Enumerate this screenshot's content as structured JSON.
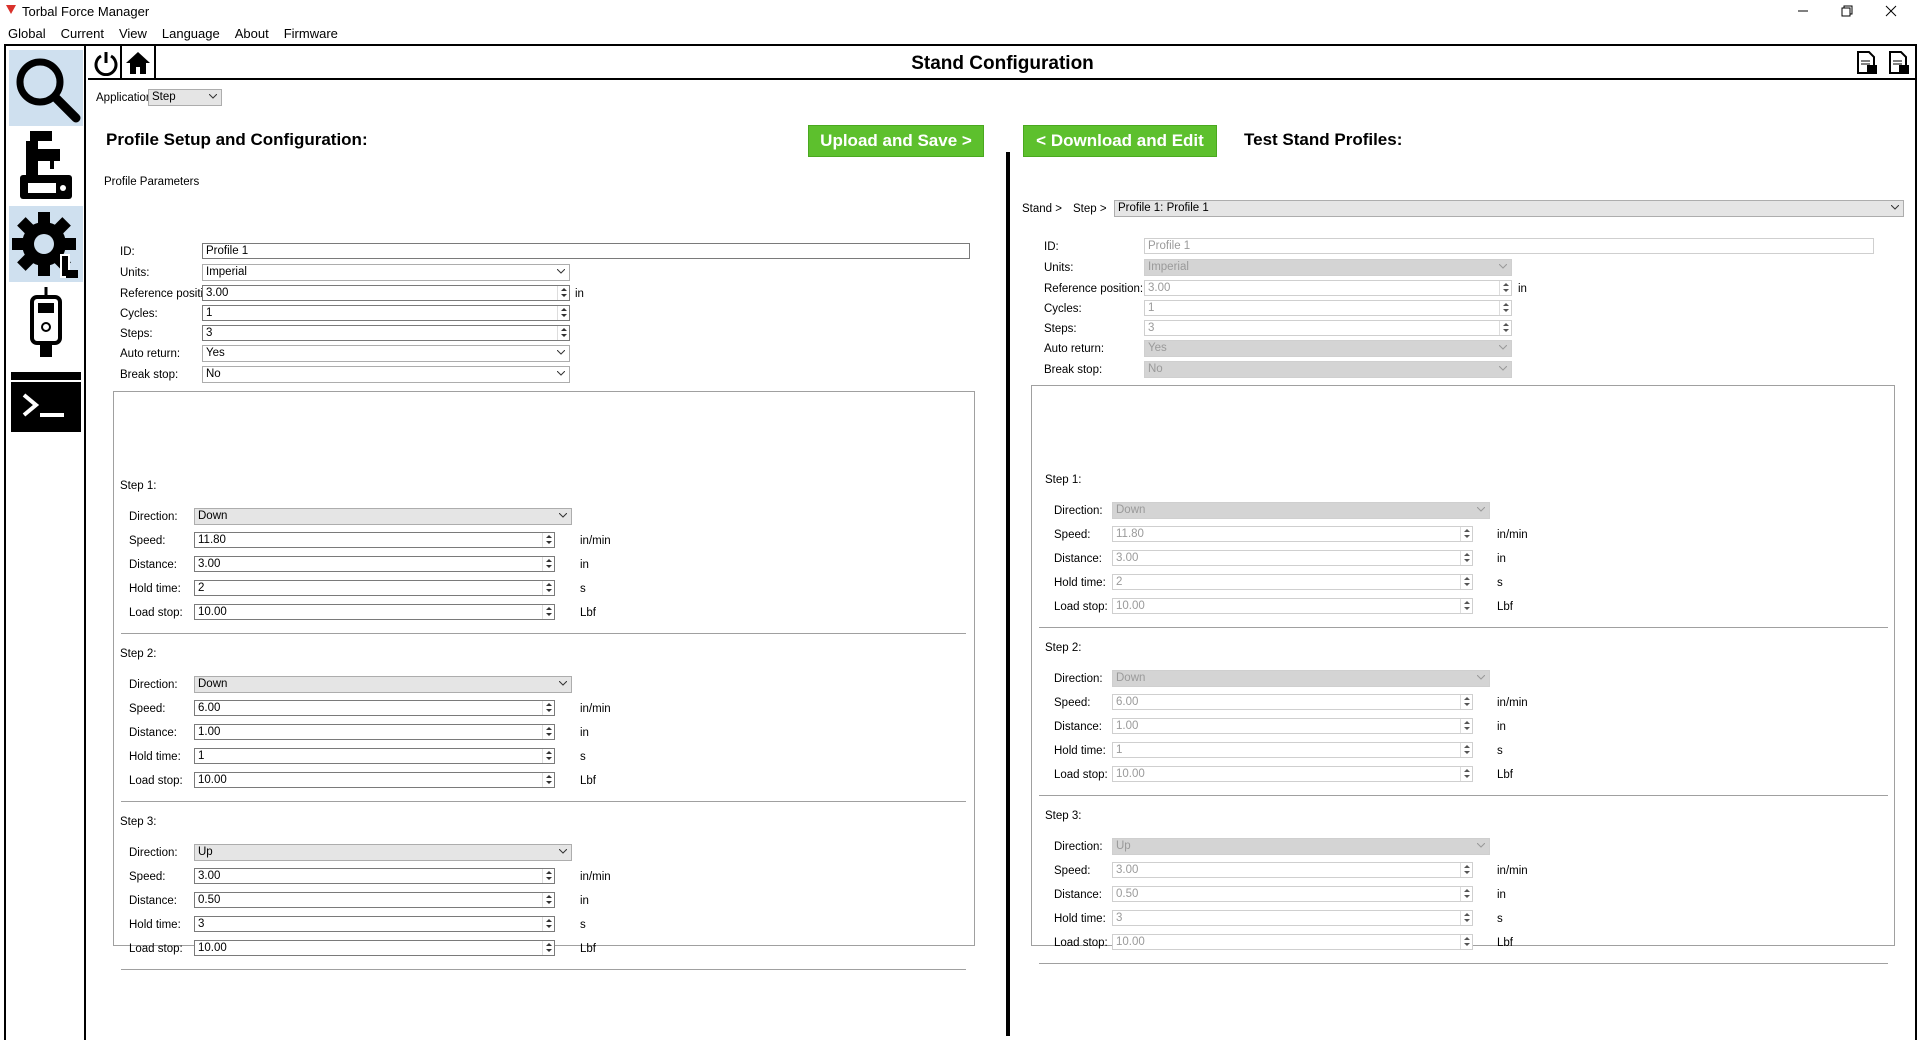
{
  "window": {
    "title": "Torbal Force Manager"
  },
  "menu": [
    "Global",
    "Current",
    "View",
    "Language",
    "About",
    "Firmware"
  ],
  "header": {
    "title": "Stand Configuration"
  },
  "sidebar": {
    "icons": [
      "search-icon",
      "stand-icon",
      "settings-icon",
      "gauge-icon",
      "terminal-icon"
    ]
  },
  "application": {
    "label": "Application:",
    "value": "Step"
  },
  "left": {
    "title": "Profile Setup and Configuration:",
    "upload_label": "Upload and Save >",
    "params_title": "Profile Parameters",
    "fields": {
      "id": {
        "label": "ID:",
        "value": "Profile 1"
      },
      "units": {
        "label": "Units:",
        "value": "Imperial"
      },
      "ref": {
        "label": "Reference position:",
        "value": "3.00",
        "unit": "in"
      },
      "cycles": {
        "label": "Cycles:",
        "value": "1"
      },
      "steps": {
        "label": "Steps:",
        "value": "3"
      },
      "auto": {
        "label": "Auto return:",
        "value": "Yes"
      },
      "brk": {
        "label": "Break stop:",
        "value": "No"
      }
    }
  },
  "right": {
    "title": "Test Stand Profiles:",
    "download_label": "< Download and Edit",
    "crumb1": "Stand >",
    "crumb2": "Step >",
    "profile_select": "Profile 1: Profile 1",
    "fields": {
      "id": {
        "label": "ID:",
        "value": "Profile 1"
      },
      "units": {
        "label": "Units:",
        "value": "Imperial"
      },
      "ref": {
        "label": "Reference position:",
        "value": "3.00",
        "unit": "in"
      },
      "cycles": {
        "label": "Cycles:",
        "value": "1"
      },
      "steps": {
        "label": "Steps:",
        "value": "3"
      },
      "auto": {
        "label": "Auto return:",
        "value": "Yes"
      },
      "brk": {
        "label": "Break stop:",
        "value": "No"
      }
    }
  },
  "step_labels": {
    "direction": "Direction:",
    "speed": "Speed:",
    "distance": "Distance:",
    "hold": "Hold time:",
    "load": "Load stop:"
  },
  "step_units": {
    "speed": "in/min",
    "distance": "in",
    "hold": "s",
    "load": "Lbf"
  },
  "steps": [
    {
      "title": "Step 1:",
      "direction": "Down",
      "speed": "11.80",
      "distance": "3.00",
      "hold": "2",
      "load": "10.00"
    },
    {
      "title": "Step 2:",
      "direction": "Down",
      "speed": "6.00",
      "distance": "1.00",
      "hold": "1",
      "load": "10.00"
    },
    {
      "title": "Step 3:",
      "direction": "Up",
      "speed": "3.00",
      "distance": "0.50",
      "hold": "3",
      "load": "10.00"
    }
  ],
  "colors": {
    "accent_green": "#5dc02d",
    "active_sidebar": "#cfe0ef"
  }
}
